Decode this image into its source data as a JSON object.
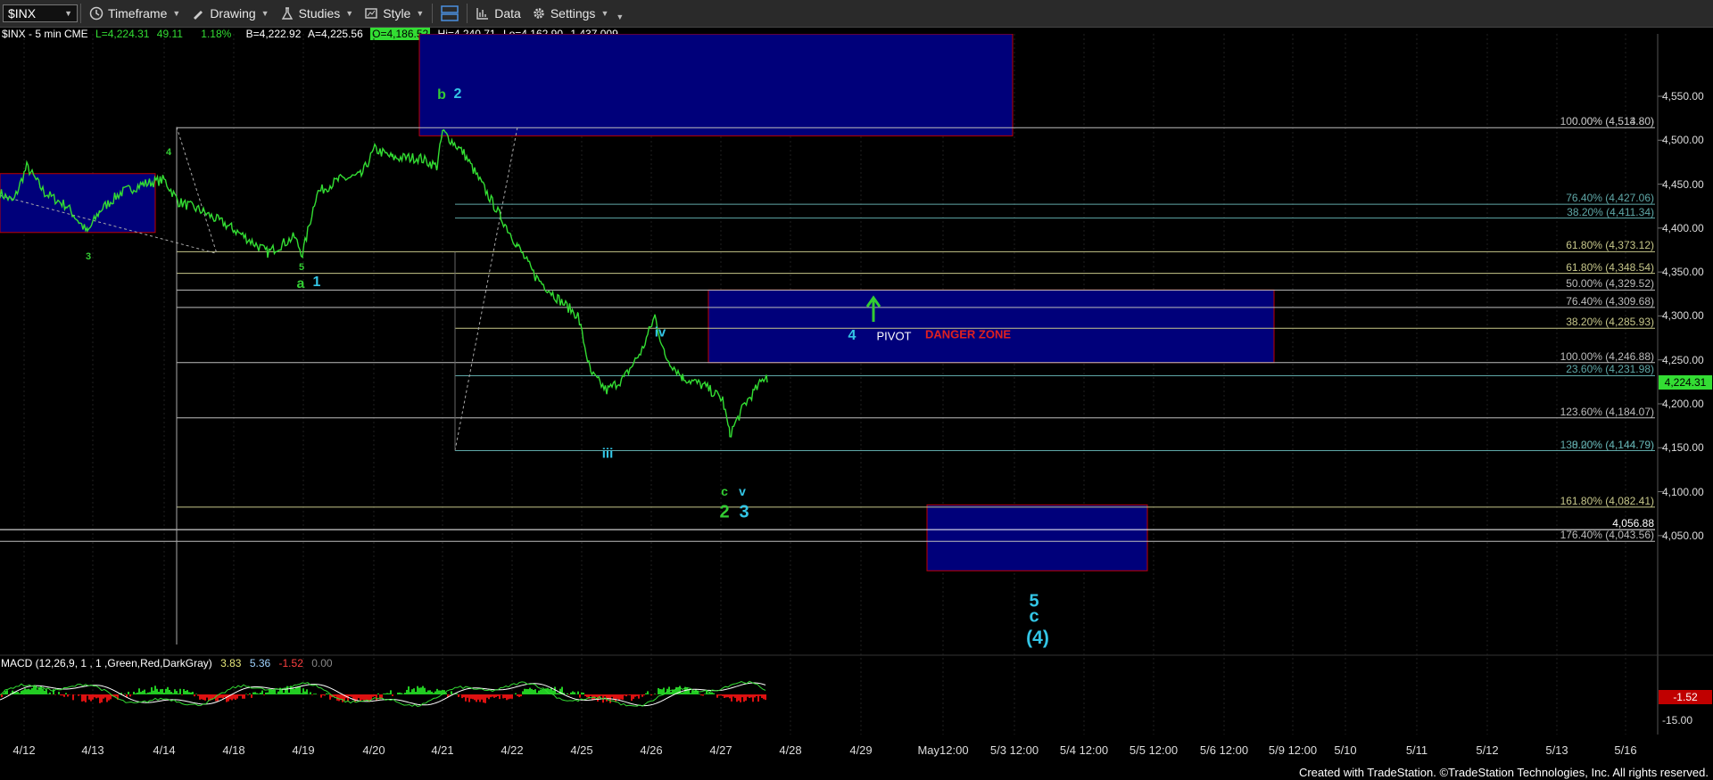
{
  "toolbar": {
    "symbol": "$INX",
    "timeframe": "Timeframe",
    "drawing": "Drawing",
    "studies": "Studies",
    "style": "Style",
    "data": "Data",
    "settings": "Settings"
  },
  "info_line": {
    "symbol": "$INX - 5 min CME",
    "last": "L=4,224.31",
    "change": "49.11",
    "pct": "1.18%",
    "bid": "B=4,222.92",
    "ask": "A=4,225.56",
    "open": "O=4,186.52",
    "high": "Hi=4,240.71",
    "low": "Lo=4,162.90",
    "volume": "1,437,009"
  },
  "price_axis": {
    "ticks": [
      "4,550.00",
      "4,500.00",
      "4,450.00",
      "4,400.00",
      "4,350.00",
      "4,300.00",
      "4,250.00",
      "4,200.00",
      "4,150.00",
      "4,100.00",
      "4,050.00"
    ],
    "values": [
      4550,
      4500,
      4450,
      4400,
      4350,
      4300,
      4250,
      4200,
      4150,
      4100,
      4050
    ],
    "current_price": "4,224.31",
    "current_value": 4224.31
  },
  "macd_axis": {
    "ticks": [
      "-15.00"
    ],
    "current": "-1.52"
  },
  "fib_levels": [
    {
      "label": "100.00% (4,514.80)",
      "overlap": "0.00% (4,513.80)",
      "value": 4514.3,
      "color": "#bdbdbd"
    },
    {
      "label": "76.40% (4,427.06)",
      "value": 4427.06,
      "color": "#5fa8a8"
    },
    {
      "label": "38.20% (4,411.34)",
      "value": 4411.34,
      "color": "#5fa8a8"
    },
    {
      "label": "61.80% (4,373.12)",
      "value": 4373.12,
      "color": "#c7c78a"
    },
    {
      "label": "61.80% (4,348.54)",
      "value": 4348.54,
      "color": "#c7c78a"
    },
    {
      "label": "50.00% (4,329.52)",
      "value": 4329.52,
      "color": "#bdbdbd"
    },
    {
      "label": "76.40% (4,309.68)",
      "value": 4309.68,
      "color": "#bdbdbd"
    },
    {
      "label": "38.20% (4,285.93)",
      "value": 4285.93,
      "color": "#c7c78a"
    },
    {
      "label": "100.00% (4,246.88)",
      "value": 4246.88,
      "color": "#bdbdbd"
    },
    {
      "label": "23.60% (4,231.98)",
      "value": 4231.98,
      "color": "#5fa8a8"
    },
    {
      "label": "123.60% (4,184.07)",
      "value": 4184.07,
      "color": "#bdbdbd"
    },
    {
      "label": "138.20% (4,144.79)",
      "overlap": "0.00% (4,144.79)",
      "value": 4146.7,
      "color": "#5fa8a8"
    },
    {
      "label": "161.80% (4,082.41)",
      "value": 4082.41,
      "color": "#c7c78a"
    },
    {
      "label": "4,056.88",
      "value": 4056.88,
      "color": "#ffffff"
    },
    {
      "label": "176.40% (4,043.56)",
      "value": 4043.56,
      "color": "#bdbdbd"
    }
  ],
  "zones": {
    "pivot_number": "4",
    "pivot": "PIVOT",
    "danger": "DANGER ZONE"
  },
  "wave_labels": {
    "b": "b",
    "two_top": "2",
    "four_left": "4",
    "three_left": "3",
    "five_small": "5",
    "a": "a",
    "one": "1",
    "iii": "iii",
    "iv": "iv",
    "c_small": "c",
    "v_small": "v",
    "two_bottom": "2",
    "three_bottom": "3",
    "five_target": "5",
    "c_target": "c",
    "four_target": "(4)"
  },
  "macd": {
    "params": "MACD (12,26,9, 1 , 1 ,Green,Red,DarkGray)",
    "macd_value": "3.83",
    "signal_value": "5.36",
    "hist_value": "-1.52",
    "zero_value": "0.00"
  },
  "dates": [
    "4/12",
    "4/13",
    "4/14",
    "4/18",
    "4/19",
    "4/20",
    "4/21",
    "4/22",
    "4/25",
    "4/26",
    "4/27",
    "4/28",
    "4/29",
    "May12:00",
    "5/3 12:00",
    "5/4 12:00",
    "5/5 12:00",
    "5/6 12:00",
    "5/9 12:00",
    "5/10",
    "5/11",
    "5/12",
    "5/13",
    "5/16"
  ],
  "footer": "Created with TradeStation. ©TradeStation Technologies, Inc. All rights reserved.",
  "colors": {
    "price_line": "#33dd33",
    "zone_fill": "#00007a",
    "zone_border": "#c00000",
    "wave_green": "#33cc33",
    "wave_cyan": "#33c6e6",
    "danger": "#e02020",
    "macd_green": "#22cc22",
    "macd_red": "#dd1111",
    "signal": "#ffffff"
  },
  "chart_data": {
    "type": "line",
    "title": "$INX - 5 min CME",
    "x": [
      "4/12",
      "4/13",
      "4/14",
      "4/18",
      "4/19",
      "4/20",
      "4/21",
      "4/22",
      "4/25",
      "4/26",
      "4/27"
    ],
    "series": [
      {
        "values": [
          4440,
          4405,
          4455,
          4380,
          4365,
          4470,
          4510,
          4400,
          4215,
          4300,
          4165
        ]
      }
    ],
    "ylim": [
      4000,
      4575
    ],
    "last_close": 4224.31,
    "targets": {
      "pivot_zone": [
        4246.88,
        4329.52
      ],
      "wave5_zone": [
        4010,
        4085
      ],
      "upper_zone": [
        4505,
        4575
      ]
    }
  }
}
